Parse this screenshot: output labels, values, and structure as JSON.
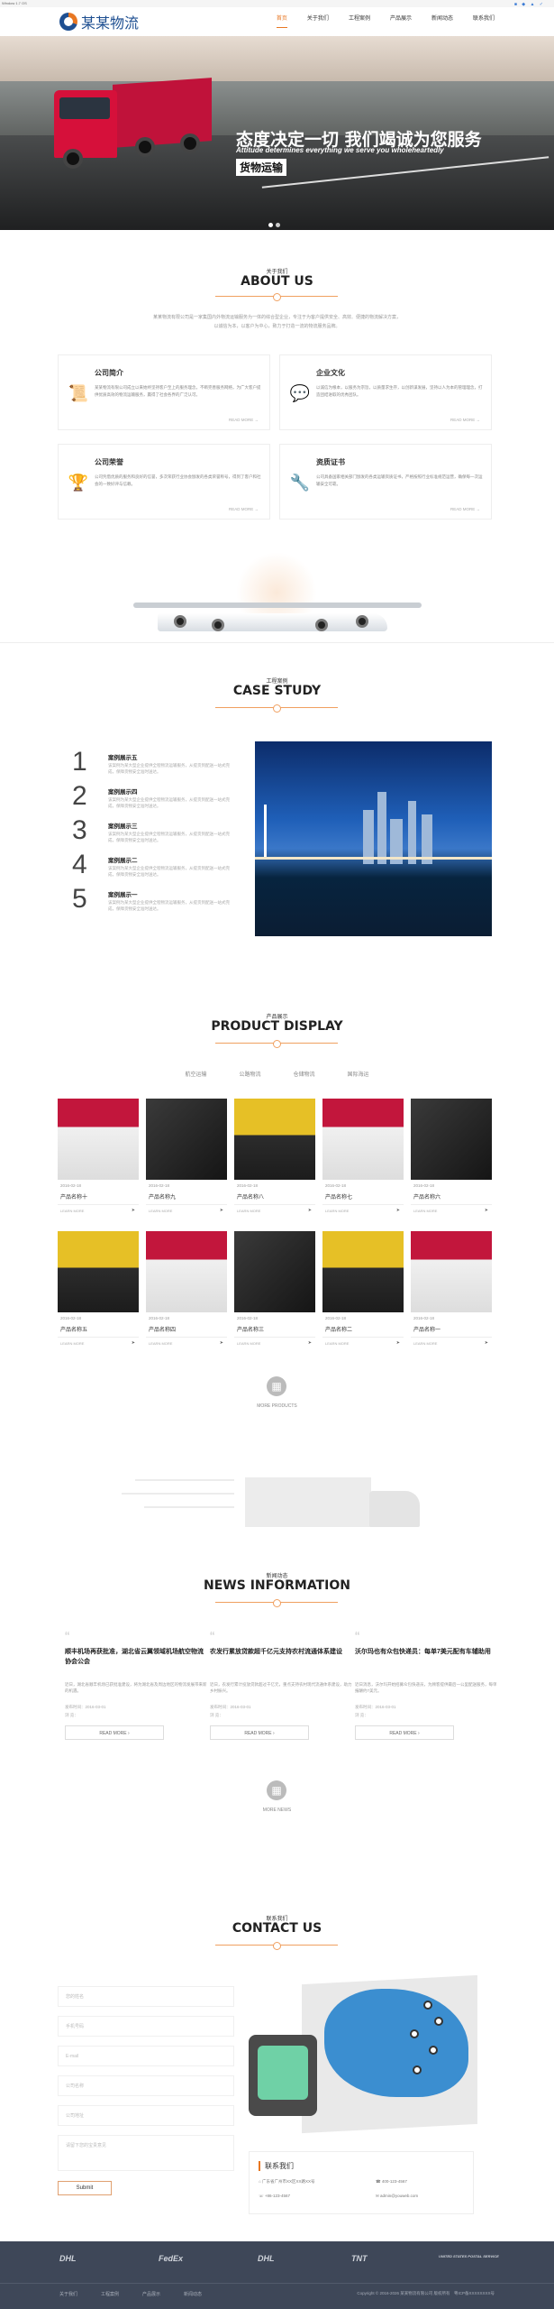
{
  "util": {
    "left": "Window 1.7 OS",
    "right": "■ ◆ ▲ ✓"
  },
  "header": {
    "logo": "某某物流",
    "nav": [
      "首页",
      "关于我们",
      "工程案例",
      "产品展示",
      "新闻动态",
      "联系我们"
    ],
    "active": 0
  },
  "banner": {
    "title": "态度决定一切 我们竭诚为您服务",
    "subtitle": "Attitude determines everything we serve you wholeheartedly",
    "tag": "货物运输"
  },
  "about": {
    "cn": "关于我们",
    "en": "ABOUT US",
    "intro": "某某物流有限公司是一家集国内外物流运输服务为一体的综合型企业，专注于为客户提供安全、高效、便捷的物流解决方案，以诚信为本，以客户为中心，致力于打造一流的物流服务品牌。",
    "cards": [
      {
        "title": "公司简介",
        "icon": "scroll-icon",
        "text": "某某物流有限公司成立以来始终坚持客户至上的服务理念，不断完善服务网络，为广大客户提供优质高效的物流运输服务，赢得了社会各界的广泛认可。",
        "more": "READ MORE"
      },
      {
        "title": "企业文化",
        "icon": "chat-icon",
        "text": "以诚信为根本，以服务为宗旨，以质量求生存，以创新谋发展，坚持以人为本的管理理念，打造团结进取的优秀团队。",
        "more": "READ MORE"
      },
      {
        "title": "公司荣誉",
        "icon": "trophy-icon",
        "text": "公司凭借优质的服务和良好的信誉，多次荣获行业协会颁发的各类荣誉称号，得到了客户和社会的一致好评与信赖。",
        "more": "READ MORE"
      },
      {
        "title": "资质证书",
        "icon": "tools-icon",
        "text": "公司具备国家相关部门颁发的各类运输资质证书，严格按照行业标准规范运营，确保每一次运输安全可靠。",
        "more": "READ MORE"
      }
    ]
  },
  "cases": {
    "cn": "工程案例",
    "en": "CASE STUDY",
    "items": [
      {
        "num": "1",
        "title": "案例展示五",
        "text": "该案例为某大型企业提供全程物流运输服务，从提货到配送一站式完成，保障货物安全准时送达。"
      },
      {
        "num": "2",
        "title": "案例展示四",
        "text": "该案例为某大型企业提供全程物流运输服务，从提货到配送一站式完成，保障货物安全准时送达。"
      },
      {
        "num": "3",
        "title": "案例展示三",
        "text": "该案例为某大型企业提供全程物流运输服务，从提货到配送一站式完成，保障货物安全准时送达。"
      },
      {
        "num": "4",
        "title": "案例展示二",
        "text": "该案例为某大型企业提供全程物流运输服务，从提货到配送一站式完成，保障货物安全准时送达。"
      },
      {
        "num": "5",
        "title": "案例展示一",
        "text": "该案例为某大型企业提供全程物流运输服务，从提货到配送一站式完成，保障货物安全准时送达。"
      }
    ]
  },
  "products": {
    "cn": "产品展示",
    "en": "PRODUCT DISPLAY",
    "tabs": [
      "航空运输",
      "公路物流",
      "仓储物流",
      "国际海运"
    ],
    "items": [
      {
        "date": "2016-02-18",
        "name": "产品名称十",
        "color": "red"
      },
      {
        "date": "2016-02-18",
        "name": "产品名称九",
        "color": "dark"
      },
      {
        "date": "2016-02-18",
        "name": "产品名称八",
        "color": "yellow"
      },
      {
        "date": "2016-02-18",
        "name": "产品名称七",
        "color": "red"
      },
      {
        "date": "2016-02-18",
        "name": "产品名称六",
        "color": "dark"
      },
      {
        "date": "2016-02-18",
        "name": "产品名称五",
        "color": "yellow"
      },
      {
        "date": "2016-02-18",
        "name": "产品名称四",
        "color": "red"
      },
      {
        "date": "2016-02-18",
        "name": "产品名称三",
        "color": "dark"
      },
      {
        "date": "2016-02-18",
        "name": "产品名称二",
        "color": "yellow"
      },
      {
        "date": "2016-02-18",
        "name": "产品名称一",
        "color": "red"
      }
    ],
    "more_label": "LEARN MORE",
    "more_products": "MORE PRODUCTS"
  },
  "news": {
    "cn": "新闻动态",
    "en": "NEWS INFORMATION",
    "items": [
      {
        "title": "顺丰机场再获批准，湖北省云翼领域机场航空物流协会公会",
        "text": "近日，湖北省顺丰机场已获批准建设，将为湖北省及周边地区的物流发展带来新的机遇。",
        "date": "发布时间：2016-03-01",
        "stat": "浏 览：",
        "btn": "READ MORE"
      },
      {
        "title": "农发行累放贷款超千亿元支持农村流通体系建设",
        "text": "近日，农发行累计投放贷款超过千亿元，重点支持农村现代流通体系建设，助力乡村振兴。",
        "date": "发布时间：2016-03-01",
        "stat": "浏 览：",
        "btn": "READ MORE"
      },
      {
        "title": "沃尔玛也有众包快递员：每单7美元配有车辅助用",
        "text": "近日消息，沃尔玛开始招募众包快递员，为顾客提供最后一公里配送服务，每单报酬约7美元。",
        "date": "发布时间：2016-03-01",
        "stat": "浏 览：",
        "btn": "READ MORE"
      }
    ],
    "more_news": "MORE NEWS"
  },
  "contact": {
    "cn": "联系我们",
    "en": "CONTACT US",
    "fields": [
      "您的姓名",
      "手机号码",
      "E-mail",
      "公司名称",
      "公司地址",
      "请留下您的宝贵意见"
    ],
    "submit": "Submit",
    "box_title": "联系我们",
    "address": "广东省广州市XX区XX路XX号",
    "phone": "400-123-4567",
    "tel": "+86-123-4567",
    "email": "admin@youweb.com"
  },
  "footer": {
    "partners": [
      "DHL",
      "FedEx",
      "DHL",
      "TNT",
      "UNITED STATES POSTAL SERVICE"
    ],
    "links": [
      "关于我们",
      "工程案例",
      "产品展示",
      "新闻动态"
    ],
    "copyright": "Copyright © 2016-2026 某某物流有限公司 版权所有　粤ICP备XXXXXXXX号"
  },
  "colors": {
    "accent": "#e87722",
    "brand": "#1e4f91",
    "footer": "#3e4758"
  }
}
